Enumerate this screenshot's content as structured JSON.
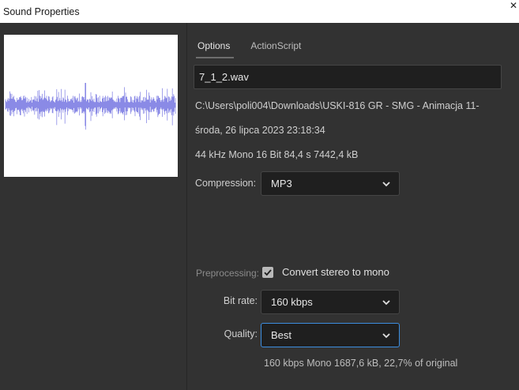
{
  "window": {
    "title": "Sound Properties",
    "close_glyph": "✕"
  },
  "tabs": [
    {
      "label": "Options",
      "active": true
    },
    {
      "label": "ActionScript",
      "active": false
    }
  ],
  "sound": {
    "name": "7_1_2.wav",
    "path": "C:\\Users\\poli004\\Downloads\\USKI-816 GR - SMG - Animacja 11-",
    "date": "środa, 26 lipca 2023  23:18:34",
    "format": "44 kHz Mono 16 Bit 84,4 s 7442,4 kB"
  },
  "compression": {
    "label": "Compression:",
    "value": "MP3"
  },
  "preprocessing": {
    "label": "Preprocessing:",
    "checked": true,
    "option_label": "Convert stereo to mono"
  },
  "bitrate": {
    "label": "Bit rate:",
    "value": "160 kbps"
  },
  "quality": {
    "label": "Quality:",
    "value": "Best"
  },
  "summary": "160 kbps  Mono 1687,6 kB, 22,7% of original",
  "icons": {
    "dropdown": "chevron-down-icon",
    "checkbox": "checkmark-icon",
    "waveform": "waveform-icon"
  },
  "colors": {
    "background": "#323232",
    "field": "#1f1f1f",
    "focus": "#3d8ee0",
    "waveform": "#8a8ae6"
  }
}
